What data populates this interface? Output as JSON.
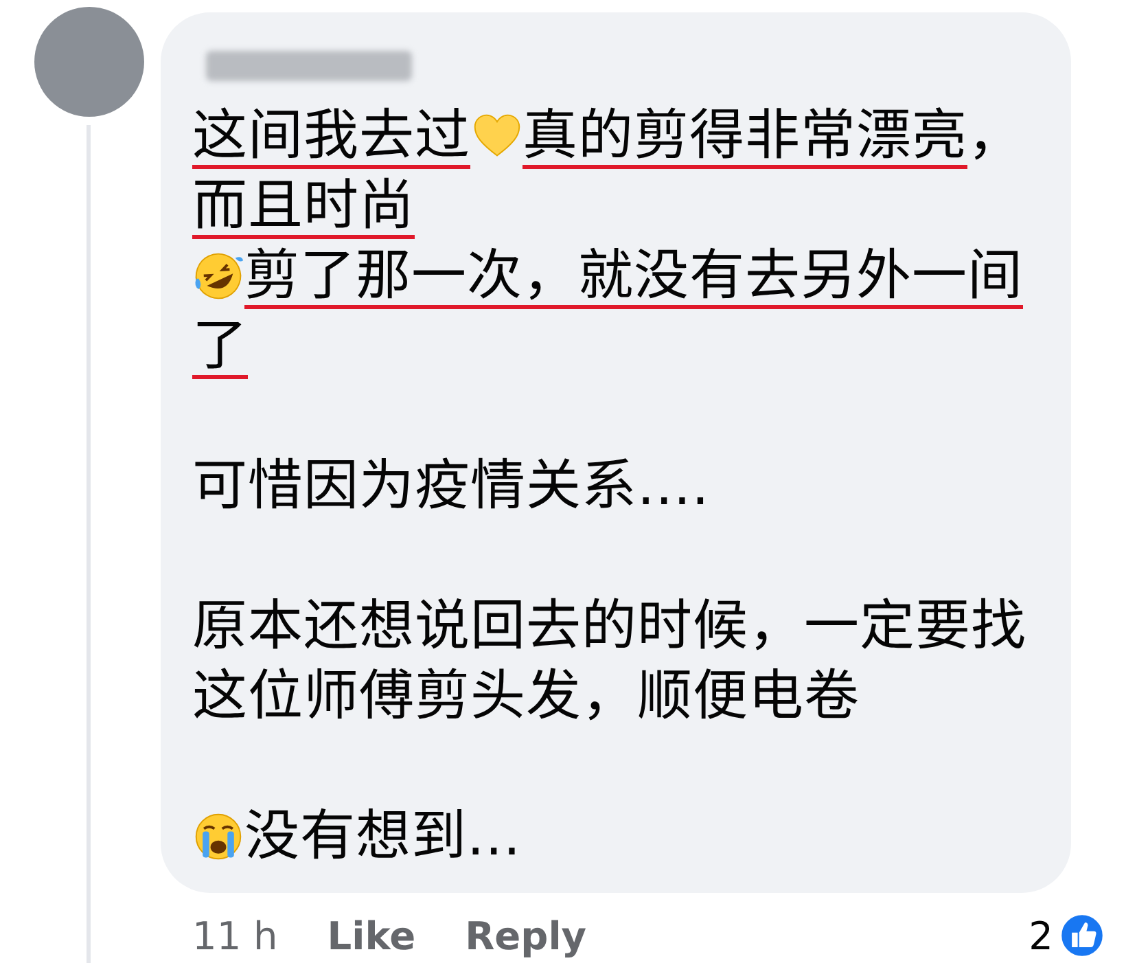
{
  "comment": {
    "paragraphs": [
      {
        "gap_before": false,
        "lines": [
          [
            {
              "kind": "text",
              "text": "这间我去过",
              "underlined": true
            },
            {
              "kind": "heart"
            },
            {
              "kind": "text",
              "text": "真的剪得非常漂亮",
              "underlined": true
            },
            {
              "kind": "text",
              "text": "，",
              "underlined": false
            }
          ],
          [
            {
              "kind": "text",
              "text": "而且时尚",
              "underlined": true
            }
          ]
        ]
      },
      {
        "gap_before": false,
        "lines": [
          [
            {
              "kind": "laughing"
            },
            {
              "kind": "text",
              "text": "剪了那一次，就没有去另外一间",
              "underlined": true
            }
          ],
          [
            {
              "kind": "text",
              "text": "了",
              "underlined": true
            }
          ]
        ]
      },
      {
        "gap_before": true,
        "lines": [
          [
            {
              "kind": "text",
              "text": "可惜因为疫情关系....",
              "underlined": false
            }
          ]
        ]
      },
      {
        "gap_before": true,
        "lines": [
          [
            {
              "kind": "text",
              "text": "原本还想说回去的时候，一定要找",
              "underlined": false
            }
          ],
          [
            {
              "kind": "text",
              "text": "这位师傅剪头发，顺便电卷",
              "underlined": false
            }
          ]
        ]
      },
      {
        "gap_before": true,
        "lines": [
          [
            {
              "kind": "crying"
            },
            {
              "kind": "text",
              "text": "没有想到...",
              "underlined": false
            }
          ]
        ]
      }
    ]
  },
  "footer": {
    "time": "11 h",
    "actions": [
      "Like",
      "Reply"
    ],
    "reaction_count": "2"
  }
}
